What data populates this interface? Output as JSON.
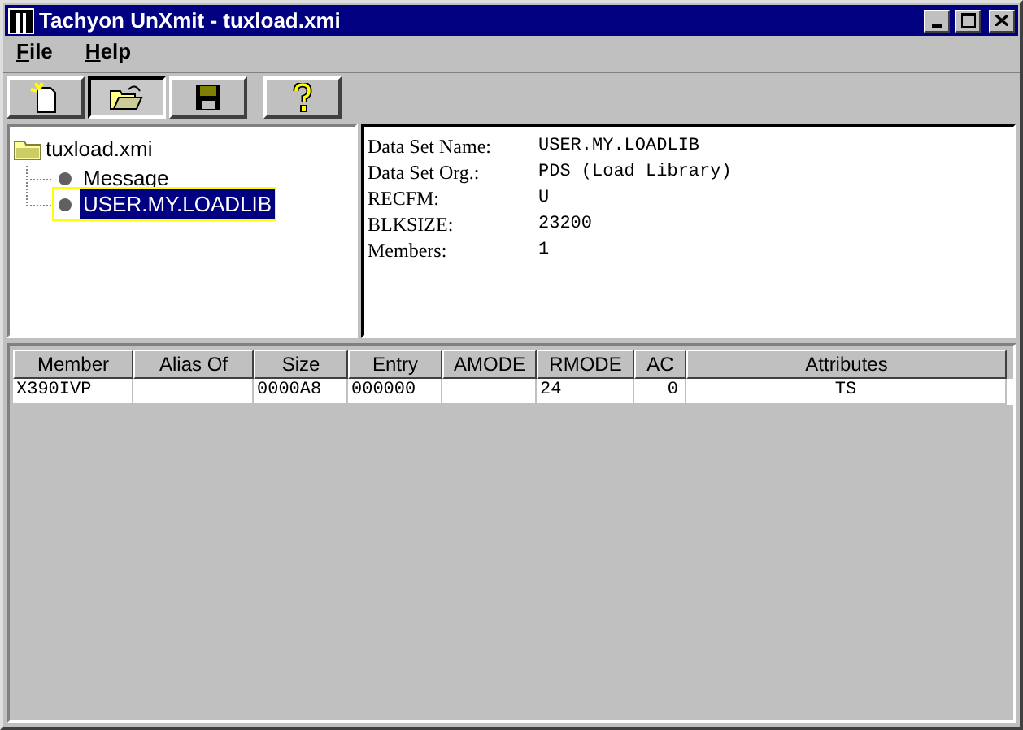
{
  "window": {
    "title": "Tachyon UnXmit - tuxload.xmi"
  },
  "menu": [
    {
      "mnemonic": "F",
      "rest": "ile"
    },
    {
      "mnemonic": "H",
      "rest": "elp"
    }
  ],
  "toolbar": [
    {
      "kind": "new",
      "pressed": false
    },
    {
      "kind": "open",
      "pressed": true
    },
    {
      "kind": "save",
      "pressed": false
    },
    {
      "kind": "help",
      "pressed": false
    }
  ],
  "tree": {
    "label": "tuxload.xmi",
    "children": [
      {
        "label": "Message",
        "selected": false
      },
      {
        "label": "USER.MY.LOADLIB",
        "selected": true
      }
    ]
  },
  "details": [
    {
      "label": "Data Set Name:",
      "value": "USER.MY.LOADLIB"
    },
    {
      "label": "Data Set Org.:",
      "value": "PDS (Load Library)"
    },
    {
      "label": "RECFM:",
      "value": "U"
    },
    {
      "label": "BLKSIZE:",
      "value": "23200"
    },
    {
      "label": "Members:",
      "value": "1"
    }
  ],
  "table": {
    "columns": [
      "Member",
      "Alias Of",
      "Size",
      "Entry",
      "AMODE",
      "RMODE",
      "AC",
      "Attributes"
    ],
    "rows": [
      [
        "X390IVP",
        "",
        "0000A8",
        "000000",
        "",
        "24",
        "0",
        "TS"
      ]
    ]
  }
}
